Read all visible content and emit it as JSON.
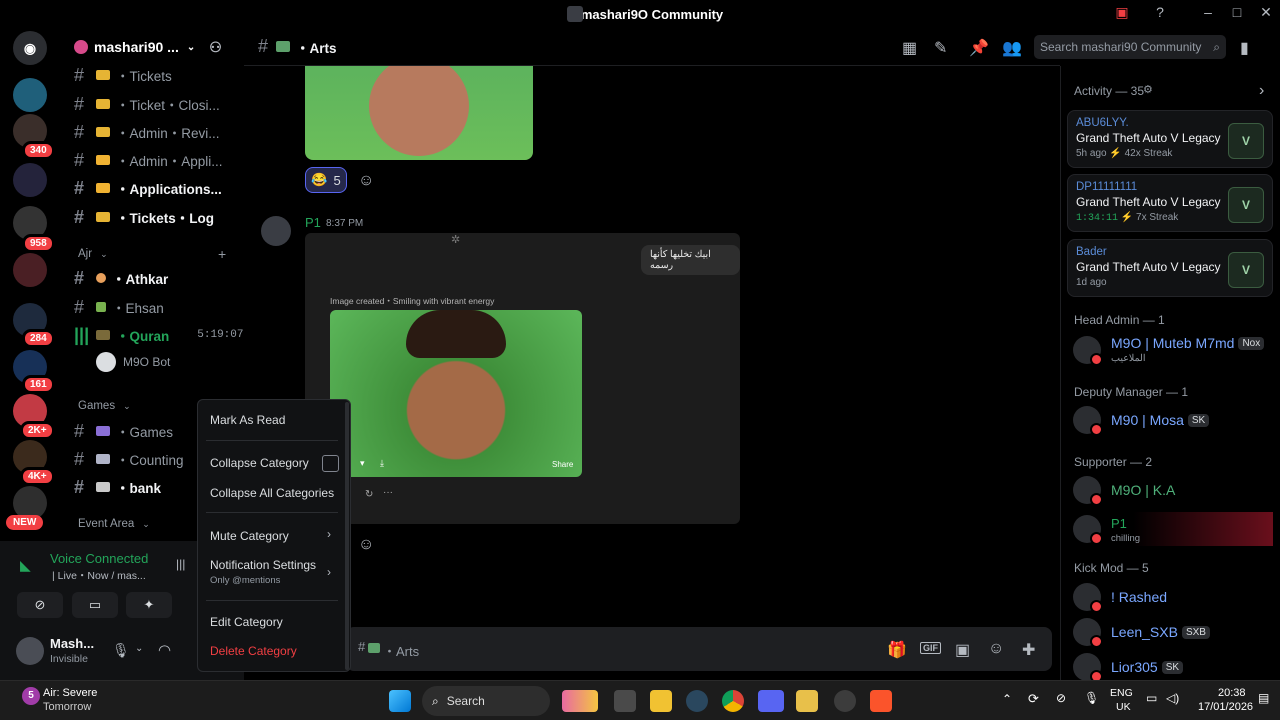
{
  "window": {
    "title": "mashari9O Community"
  },
  "server": {
    "name": "mashari90 ...",
    "search_placeholder": "Search mashari90 Community"
  },
  "server_badges": [
    "340",
    "958",
    "284",
    "161",
    "2K+",
    "4K+"
  ],
  "server_new": "NEW",
  "channels": {
    "top": [
      {
        "label": "・Tickets"
      },
      {
        "label": "・Ticket・Closi..."
      },
      {
        "label": "・Admin・Revi..."
      },
      {
        "label": "・Admin・Appli..."
      },
      {
        "label": "・Applications..."
      },
      {
        "label": "・Tickets・Log"
      }
    ],
    "cat_ajr": "Ajr",
    "ajr": [
      {
        "label": "・Athkar"
      },
      {
        "label": "・Ehsan"
      },
      {
        "label": "・Quran",
        "timer": "5:19:07"
      }
    ],
    "bot": "M9O Bot",
    "cat_games": "Games",
    "games": [
      {
        "label": "・Games"
      },
      {
        "label": "・Counting"
      },
      {
        "label": "・bank"
      }
    ],
    "cat_event": "Event Area"
  },
  "voice": {
    "status": "Voice Connected",
    "sub": "| Live・Now / mas..."
  },
  "user": {
    "name": "Mash...",
    "status": "Invisible"
  },
  "header": {
    "channel": "・Arts"
  },
  "chat": {
    "reaction_count": "5",
    "author": "P1",
    "time": "8:37 PM",
    "bubble": "ابيك تخليها كأنها رسمه",
    "image_caption": "Image created・Smiling with vibrant energy",
    "share": "Share"
  },
  "composer": {
    "channel": "・Arts"
  },
  "context_menu": {
    "mark_read": "Mark As Read",
    "collapse": "Collapse Category",
    "collapse_all": "Collapse All Categories",
    "mute": "Mute Category",
    "notif": "Notification Settings",
    "notif_sub": "Only @mentions",
    "edit": "Edit Category",
    "delete": "Delete Category"
  },
  "activity": {
    "title": "Activity — 35",
    "cards": [
      {
        "user": "ABU6LYY.",
        "game": "Grand Theft Auto V Legacy",
        "meta": "5h ago  ⚡ 42x Streak"
      },
      {
        "user": "DP11111111",
        "game": "Grand Theft Auto V Legacy",
        "time": "1:34:11",
        "meta": "⚡ 7x Streak"
      },
      {
        "user": "Bader",
        "game": "Grand Theft Auto V Legacy",
        "meta": "1d ago"
      }
    ],
    "gta_label": "V"
  },
  "members": {
    "head_admin": "Head Admin — 1",
    "muteb": "M9O | Muteb M7md",
    "muteb_tag": "Nox",
    "muteb_sub": "الملاعيب",
    "deputy": "Deputy Manager — 1",
    "mosa": "M90 | Mosa",
    "mosa_tag": "SK",
    "supporter": "Supporter — 2",
    "ka": "M9O | K.A",
    "p1": "P1",
    "p1_sub": "chilling",
    "kick": "Kick Mod — 5",
    "rashed": "! Rashed",
    "leen": "Leen_SXB",
    "leen_tag": "SXB",
    "lior": "Lior305",
    "lior_tag": "SK"
  },
  "taskbar": {
    "weather": "Air: Severe",
    "weather_sub": "Tomorrow",
    "weather_num": "5",
    "search": "Search",
    "lang": "ENG",
    "region": "UK",
    "time": "20:38",
    "date": "17/01/2026"
  },
  "colors": {
    "accent": "#5865f2",
    "green": "#23a55a",
    "red": "#f23f43",
    "link": "#5b8cd8"
  }
}
